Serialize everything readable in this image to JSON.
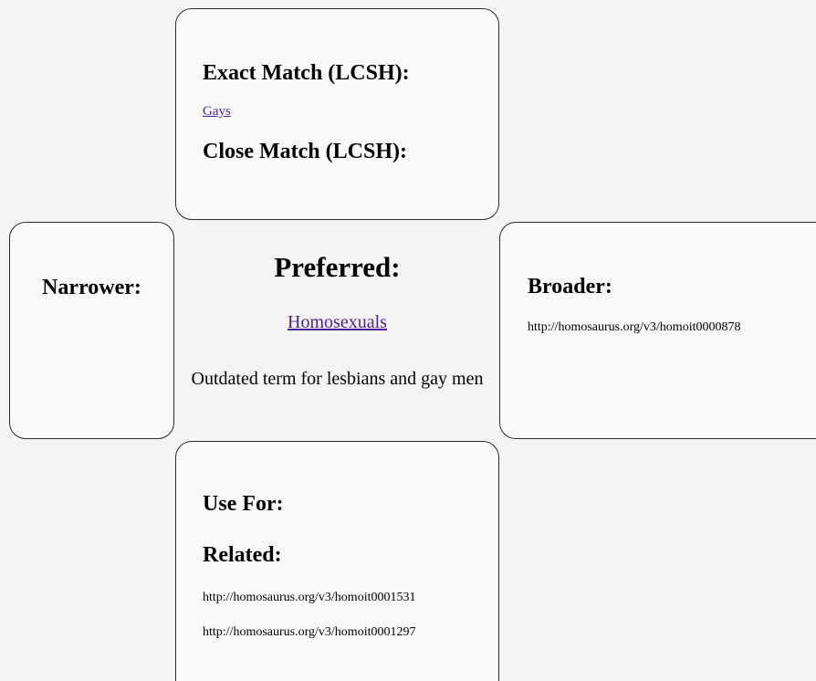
{
  "exact_match": {
    "heading": "Exact Match (LCSH):",
    "link": "Gays"
  },
  "close_match": {
    "heading": "Close Match (LCSH):"
  },
  "narrower": {
    "heading": "Narrower:"
  },
  "preferred": {
    "heading": "Preferred:",
    "term": "Homosexuals",
    "definition": "Outdated term for lesbians and gay men"
  },
  "broader": {
    "heading": "Broader:",
    "uri": "http://homosaurus.org/v3/homoit0000878"
  },
  "use_for": {
    "heading": "Use For:"
  },
  "related": {
    "heading": "Related:",
    "uris": [
      "http://homosaurus.org/v3/homoit0001531",
      "http://homosaurus.org/v3/homoit0001297"
    ]
  }
}
